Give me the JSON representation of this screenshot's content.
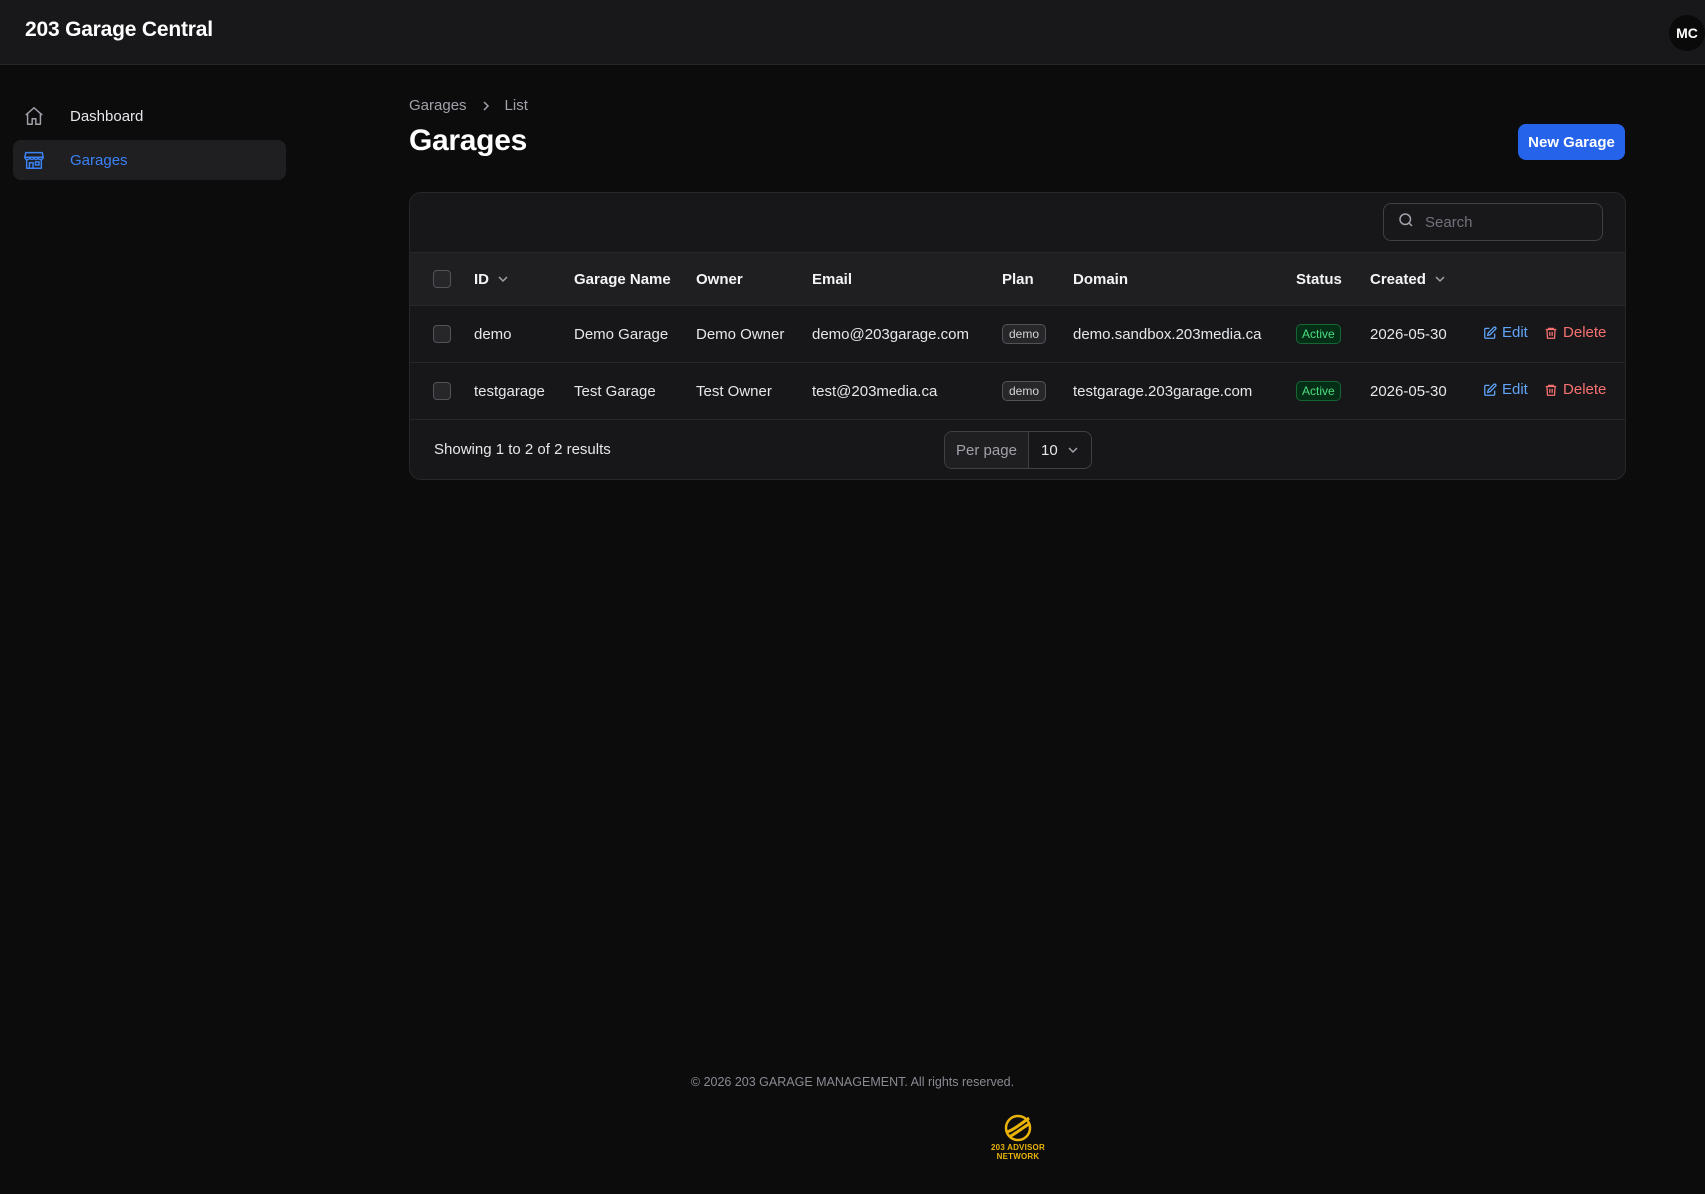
{
  "app": {
    "title": "203 Garage Central",
    "avatar_initials": "MC"
  },
  "sidebar": {
    "items": [
      {
        "label": "Dashboard",
        "icon": "home-icon",
        "active": false
      },
      {
        "label": "Garages",
        "icon": "building-storefront-icon",
        "active": true
      }
    ]
  },
  "breadcrumb": {
    "parent": "Garages",
    "current": "List"
  },
  "page": {
    "title": "Garages",
    "new_button": "New Garage"
  },
  "search": {
    "placeholder": "Search"
  },
  "table": {
    "columns": [
      "ID",
      "Garage Name",
      "Owner",
      "Email",
      "Plan",
      "Domain",
      "Status",
      "Created"
    ],
    "rows": [
      {
        "id": "demo",
        "name": "Demo Garage",
        "owner": "Demo Owner",
        "email": "demo@203garage.com",
        "plan": "demo",
        "domain": "demo.sandbox.203media.ca",
        "status": "Active",
        "created": "2026-05-30"
      },
      {
        "id": "testgarage",
        "name": "Test Garage",
        "owner": "Test Owner",
        "email": "test@203media.ca",
        "plan": "demo",
        "domain": "testgarage.203garage.com",
        "status": "Active",
        "created": "2026-05-30"
      }
    ],
    "actions": {
      "edit": "Edit",
      "delete": "Delete"
    }
  },
  "pagination": {
    "showing": "Showing 1 to 2 of 2 results",
    "per_page_label": "Per page",
    "per_page_value": "10"
  },
  "footer": {
    "copyright": "© 2026 203 GARAGE MANAGEMENT. All rights reserved.",
    "logo_line1": "203 ADVISOR",
    "logo_line2": "NETWORK"
  },
  "colors": {
    "accent": "#2563eb",
    "link": "#60a5fa",
    "danger": "#f87171",
    "success": "#4ade80",
    "logo": "#eab308"
  }
}
